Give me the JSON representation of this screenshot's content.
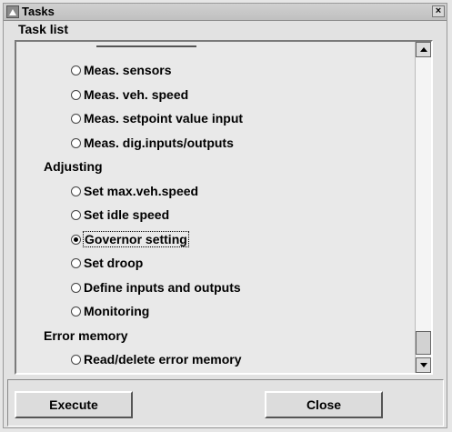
{
  "window": {
    "title": "Tasks",
    "close_glyph": "×"
  },
  "group": {
    "label": "Task list"
  },
  "task_list": {
    "rows": [
      {
        "kind": "option",
        "label": "Meas. sensors",
        "checked": false
      },
      {
        "kind": "option",
        "label": "Meas. veh. speed",
        "checked": false
      },
      {
        "kind": "option",
        "label": "Meas. setpoint value input",
        "checked": false
      },
      {
        "kind": "option",
        "label": "Meas. dig.inputs/outputs",
        "checked": false
      },
      {
        "kind": "category",
        "label": "Adjusting"
      },
      {
        "kind": "option",
        "label": "Set max.veh.speed",
        "checked": false
      },
      {
        "kind": "option",
        "label": "Set idle speed",
        "checked": false
      },
      {
        "kind": "option",
        "label": "Governor setting",
        "checked": true
      },
      {
        "kind": "option",
        "label": "Set droop",
        "checked": false
      },
      {
        "kind": "option",
        "label": "Define inputs and outputs",
        "checked": false
      },
      {
        "kind": "option",
        "label": "Monitoring",
        "checked": false
      },
      {
        "kind": "category",
        "label": "Error memory"
      },
      {
        "kind": "option",
        "label": "Read/delete error memory",
        "checked": false
      }
    ]
  },
  "buttons": {
    "execute_label": "Execute",
    "close_label": "Close"
  },
  "icons": {
    "app": "window-icon",
    "scroll_up": "scroll-up-arrow-icon",
    "scroll_down": "scroll-down-arrow-icon"
  }
}
